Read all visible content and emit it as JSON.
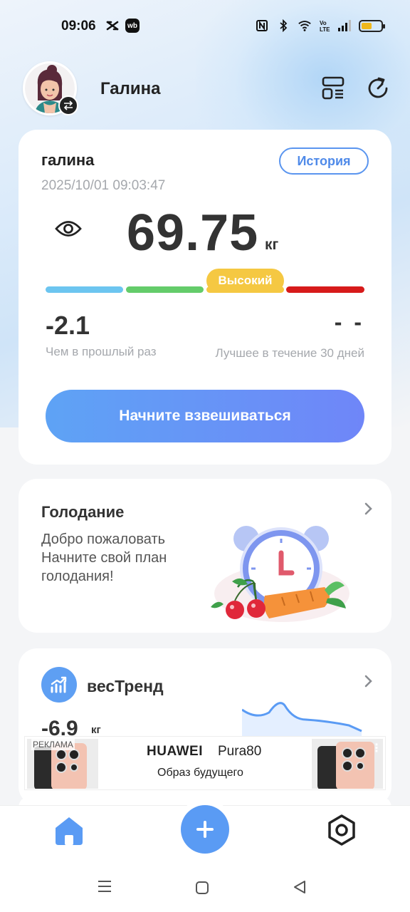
{
  "status_bar": {
    "time": "09:06",
    "wb_label": "wb",
    "battery_level": 0.55,
    "battery_color": "#f0b81c"
  },
  "header": {
    "username": "Галина",
    "icons": [
      "avatar",
      "swap-icon",
      "layout-icon",
      "sync-icon"
    ]
  },
  "weight_card": {
    "profile_name": "галина",
    "history_label": "История",
    "timestamp": "2025/10/01 09:03:47",
    "weight": "69.75",
    "unit": "кг",
    "level_label": "Высокий",
    "level_colors": [
      "#6cc5f0",
      "#64cc6a",
      "#f5c842",
      "#d71a1a"
    ],
    "diff_value": "-2.1",
    "diff_label": "Чем в прошлый раз",
    "best_value": "- -",
    "best_label": "Лучшее в течение 30 дней",
    "start_button": "Начните взвешиваться"
  },
  "fasting_card": {
    "title": "Голодание",
    "description": "Добро пожаловать Начните свой план голодания!"
  },
  "trend_card": {
    "title": "весТренд",
    "value": "-6.9",
    "unit": "кг"
  },
  "ad": {
    "label": "РЕКЛАМА",
    "brand": "HUAWEI",
    "model": "Pura80",
    "tagline": "Образ будущего"
  },
  "colors": {
    "accent": "#5a9bf4",
    "button_gradient_start": "#5ea3f5",
    "button_gradient_end": "#6f86f8"
  }
}
